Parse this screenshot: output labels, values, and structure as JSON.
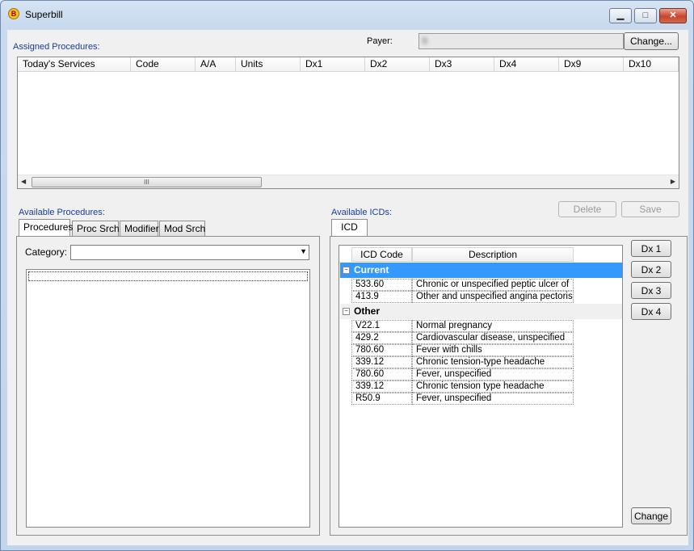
{
  "window": {
    "title": "Superbill",
    "app_icon": "superbill-app-icon"
  },
  "assigned": {
    "label": "Assigned Procedures:",
    "payer_label": "Payer:",
    "payer_value": "S",
    "change_label": "Change...",
    "columns": [
      "Today's Services",
      "Code",
      "A/A",
      "Units",
      "Dx1",
      "Dx2",
      "Dx3",
      "Dx4",
      "Dx9",
      "Dx10"
    ]
  },
  "available_procedures": {
    "label": "Available Procedures:",
    "tabs": [
      "Procedures",
      "Proc Srch",
      "Modifier",
      "Mod Srch"
    ],
    "category_label": "Category:",
    "category_value": ""
  },
  "available_icds": {
    "label": "Available ICDs:",
    "tab": "ICD",
    "delete_label": "Delete",
    "save_label": "Save",
    "columns": [
      "ICD Code",
      "Description"
    ],
    "groups": [
      {
        "name": "Current",
        "rows": [
          {
            "code": "533.60",
            "desc": "Chronic or unspecified peptic ulcer of"
          },
          {
            "code": "413.9",
            "desc": "Other and unspecified angina pectoris"
          }
        ]
      },
      {
        "name": "Other",
        "rows": [
          {
            "code": "V22.1",
            "desc": "Normal pregnancy"
          },
          {
            "code": "429.2",
            "desc": "Cardiovascular disease, unspecified"
          },
          {
            "code": "780.60",
            "desc": "Fever with chills"
          },
          {
            "code": "339.12",
            "desc": "Chronic tension-type headache"
          },
          {
            "code": "780.60",
            "desc": "Fever, unspecified"
          },
          {
            "code": "339.12",
            "desc": "Chronic tension type headache"
          },
          {
            "code": "R50.9",
            "desc": "Fever, unspecified"
          }
        ]
      }
    ],
    "dx_buttons": [
      "Dx 1",
      "Dx 2",
      "Dx 3",
      "Dx 4"
    ],
    "change_label": "Change"
  },
  "colors": {
    "selected_row": "#3399ff",
    "label_blue": "#1a3b9a"
  }
}
